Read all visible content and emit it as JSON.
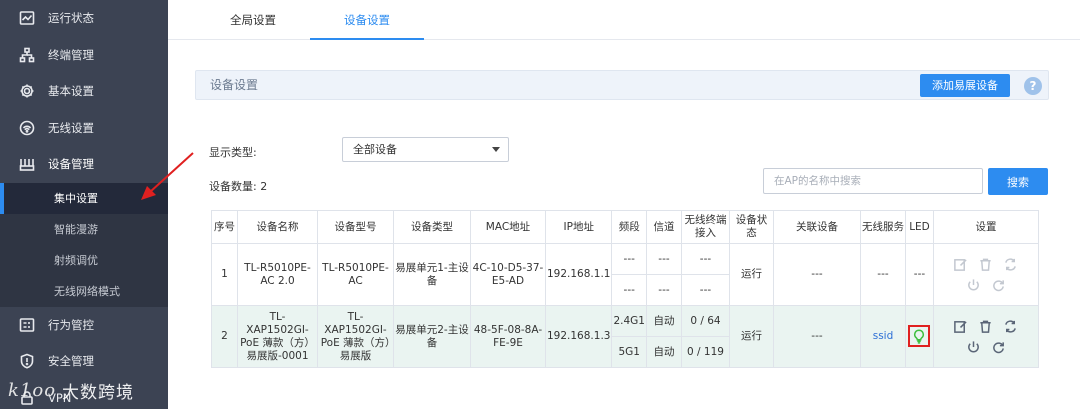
{
  "sidebar": {
    "items_top": [
      {
        "label": "运行状态",
        "icon": "dashboard-icon"
      },
      {
        "label": "终端管理",
        "icon": "topology-icon"
      },
      {
        "label": "基本设置",
        "icon": "gear-icon"
      },
      {
        "label": "无线设置",
        "icon": "wifi-icon"
      },
      {
        "label": "设备管理",
        "icon": "router-icon"
      }
    ],
    "sub_items": [
      "集中设置",
      "智能漫游",
      "射频调优",
      "无线网络模式"
    ],
    "items_bottom": [
      {
        "label": "行为管控",
        "icon": "control-icon"
      },
      {
        "label": "安全管理",
        "icon": "shield-icon"
      },
      {
        "label": "VPN",
        "icon": "vpn-icon"
      }
    ],
    "watermark": "大数跨境",
    "watermark_logo": "k1oo"
  },
  "tabs": [
    "全局设置",
    "设备设置"
  ],
  "section": {
    "title": "设备设置",
    "add_button": "添加易展设备",
    "help": "?"
  },
  "filter": {
    "label": "显示类型:",
    "selected": "全部设备"
  },
  "count_label": "设备数量: 2",
  "search": {
    "placeholder": "在AP的名称中搜索",
    "button": "搜索"
  },
  "table": {
    "headers": [
      "序号",
      "设备名称",
      "设备型号",
      "设备类型",
      "MAC地址",
      "IP地址",
      "频段",
      "信道",
      "无线终端接入",
      "设备状态",
      "关联设备",
      "无线服务",
      "LED",
      "设置"
    ],
    "rows": [
      {
        "index": "1",
        "name": "TL-R5010PE-AC 2.0",
        "model": "TL-R5010PE-AC",
        "type": "易展单元1-主设备",
        "mac": "4C-10-D5-37-E5-AD",
        "ip": "192.168.1.1",
        "band1": "---",
        "chan1": "---",
        "clients1": "---",
        "band2": "---",
        "chan2": "---",
        "clients2": "---",
        "status": "运行",
        "assoc": "---",
        "ssid": "---",
        "led": "---"
      },
      {
        "index": "2",
        "name": "TL-XAP1502GI-PoE 薄款（方）易展版-0001",
        "model": "TL-XAP1502GI-PoE 薄款（方）易展版",
        "type": "易展单元2-主设备",
        "mac": "48-5F-08-8A-FE-9E",
        "ip": "192.168.1.3",
        "band1": "2.4G1",
        "chan1": "自动",
        "clients1": "0 / 64",
        "band2": "5G1",
        "chan2": "自动",
        "clients2": "0 / 119",
        "status": "运行",
        "assoc": "---",
        "ssid": "ssid",
        "led": "lightbulb-icon"
      }
    ]
  },
  "colors": {
    "accent": "#2d8cf0",
    "sidebar_bg": "#3c4353",
    "row_highlight": "#eaf4f1",
    "annotation": "#e02020",
    "led_on": "#3fbf3f"
  }
}
